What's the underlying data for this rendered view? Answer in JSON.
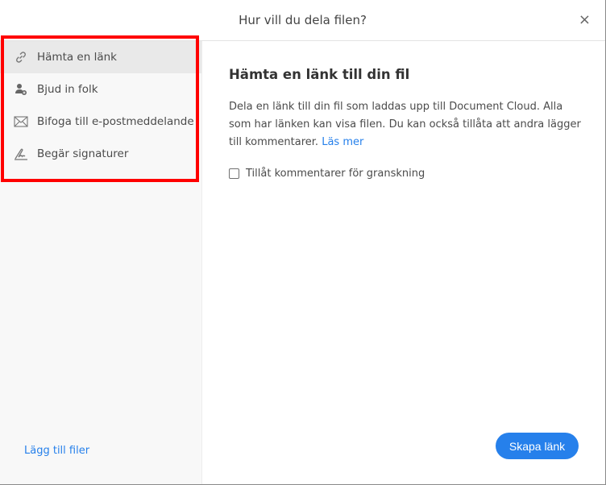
{
  "header": {
    "title": "Hur vill du dela filen?",
    "close": "×"
  },
  "sidebar": {
    "items": [
      {
        "label": "Hämta en länk",
        "icon": "link-icon"
      },
      {
        "label": "Bjud in folk",
        "icon": "add-person-icon"
      },
      {
        "label": "Bifoga till e-postmeddelande",
        "icon": "envelope-icon"
      },
      {
        "label": "Begär signaturer",
        "icon": "signature-icon"
      }
    ],
    "add_files": "Lägg till filer"
  },
  "main": {
    "heading": "Hämta en länk till din fil",
    "description": "Dela en länk till din fil som laddas upp till Document Cloud. Alla som har länken kan visa filen. Du kan också tillåta att andra lägger till kommentarer.",
    "learn_more": "Läs mer",
    "checkbox_label": "Tillåt kommentarer för granskning",
    "checkbox_checked": false,
    "create_button": "Skapa länk"
  },
  "colors": {
    "accent": "#2680eb",
    "highlight": "#ff0000"
  }
}
